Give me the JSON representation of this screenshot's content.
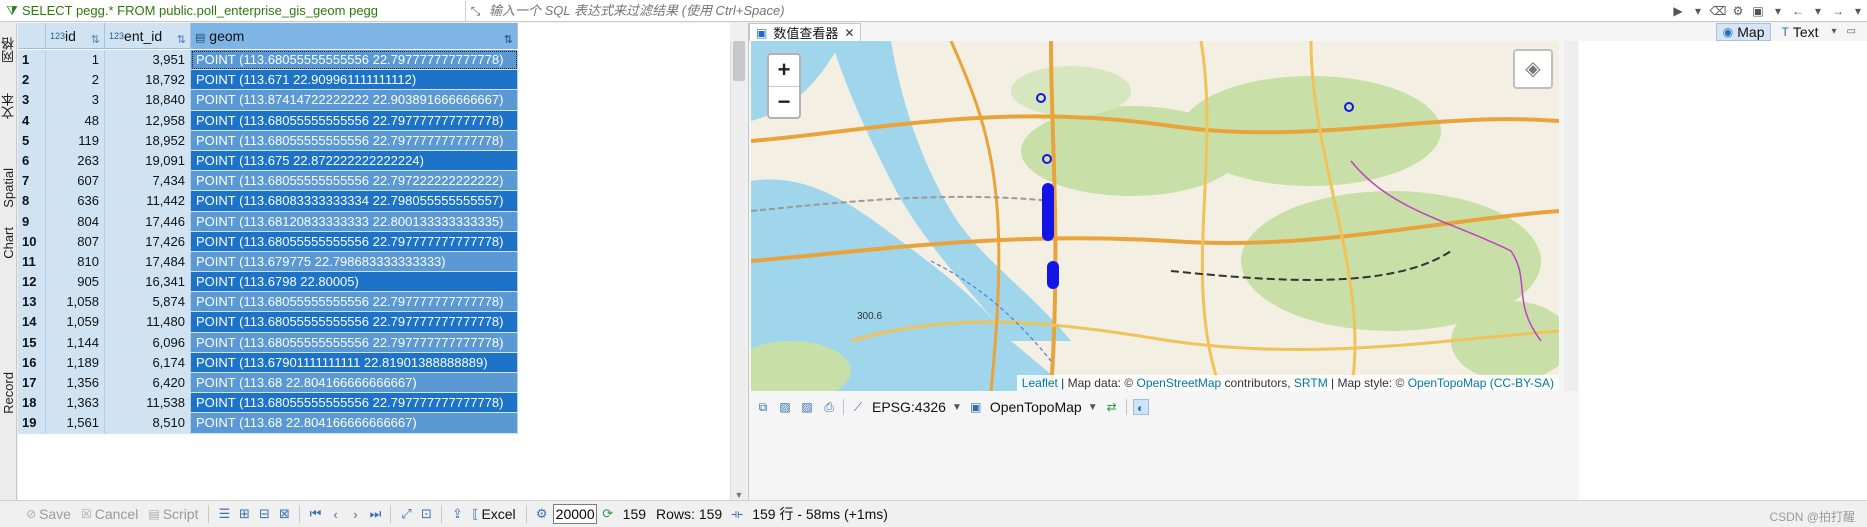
{
  "filter": {
    "sql": "SELECT pegg.* FROM public.poll_enterprise_gis_geom pegg",
    "placeholder": "输入一个 SQL 表达式来过滤结果 (使用 Ctrl+Space)"
  },
  "side_tabs": [
    "网格",
    "文本",
    "Spatial",
    "Chart",
    "Record"
  ],
  "grid": {
    "columns": [
      {
        "type": "123",
        "name": "id"
      },
      {
        "type": "123",
        "name": "ent_id"
      },
      {
        "type": "geom-icon",
        "name": "geom"
      }
    ],
    "rows": [
      {
        "n": "1",
        "id": "1",
        "ent_id": "3,951",
        "geom": "POINT (113.68055555555556 22.797777777777778)"
      },
      {
        "n": "2",
        "id": "2",
        "ent_id": "18,792",
        "geom": "POINT (113.671 22.909961111111112)"
      },
      {
        "n": "3",
        "id": "3",
        "ent_id": "18,840",
        "geom": "POINT (113.87414722222222 22.903891666666667)"
      },
      {
        "n": "4",
        "id": "48",
        "ent_id": "12,958",
        "geom": "POINT (113.68055555555556 22.797777777777778)"
      },
      {
        "n": "5",
        "id": "119",
        "ent_id": "18,952",
        "geom": "POINT (113.68055555555556 22.797777777777778)"
      },
      {
        "n": "6",
        "id": "263",
        "ent_id": "19,091",
        "geom": "POINT (113.675 22.872222222222224)"
      },
      {
        "n": "7",
        "id": "607",
        "ent_id": "7,434",
        "geom": "POINT (113.68055555555556 22.797222222222222)"
      },
      {
        "n": "8",
        "id": "636",
        "ent_id": "11,442",
        "geom": "POINT (113.68083333333334 22.798055555555557)"
      },
      {
        "n": "9",
        "id": "804",
        "ent_id": "17,446",
        "geom": "POINT (113.68120833333333 22.800133333333335)"
      },
      {
        "n": "10",
        "id": "807",
        "ent_id": "17,426",
        "geom": "POINT (113.68055555555556 22.797777777777778)"
      },
      {
        "n": "11",
        "id": "810",
        "ent_id": "17,484",
        "geom": "POINT (113.679775 22.798683333333333)"
      },
      {
        "n": "12",
        "id": "905",
        "ent_id": "16,341",
        "geom": "POINT (113.6798 22.80005)"
      },
      {
        "n": "13",
        "id": "1,058",
        "ent_id": "5,874",
        "geom": "POINT (113.68055555555556 22.797777777777778)"
      },
      {
        "n": "14",
        "id": "1,059",
        "ent_id": "11,480",
        "geom": "POINT (113.68055555555556 22.797777777777778)"
      },
      {
        "n": "15",
        "id": "1,144",
        "ent_id": "6,096",
        "geom": "POINT (113.68055555555556 22.797777777777778)"
      },
      {
        "n": "16",
        "id": "1,189",
        "ent_id": "6,174",
        "geom": "POINT (113.67901111111111 22.81901388888889)"
      },
      {
        "n": "17",
        "id": "1,356",
        "ent_id": "6,420",
        "geom": "POINT (113.68 22.804166666666667)"
      },
      {
        "n": "18",
        "id": "1,363",
        "ent_id": "11,538",
        "geom": "POINT (113.68055555555556 22.797777777777778)"
      },
      {
        "n": "19",
        "id": "1,561",
        "ent_id": "8,510",
        "geom": "POINT (113.68 22.804166666666667)"
      }
    ]
  },
  "viewer": {
    "tab_title": "数值查看器",
    "mode_map": "Map",
    "mode_text": "Text",
    "zoom_in": "+",
    "zoom_out": "−",
    "crs": "EPSG:4326",
    "basemap": "OpenTopoMap",
    "attribution": {
      "leaflet": "Leaflet",
      "sep1": " | Map data: © ",
      "osm": "OpenStreetMap",
      "contrib": " contributors, ",
      "srtm": "SRTM",
      "style": " | Map style: © ",
      "otm": "OpenTopoMap",
      "lic": "(CC-BY-SA)"
    },
    "map_labels": [
      "300.6"
    ]
  },
  "status": {
    "save": "Save",
    "cancel": "Cancel",
    "script": "Script",
    "excel": "Excel",
    "fetch_size": "20000",
    "count": "159",
    "rows": "Rows: 159",
    "summary": "159 行 - 58ms (+1ms)",
    "watermark": "CSDN @拍打醒"
  },
  "colors": {
    "geom_dark": "#1c73c8",
    "geom_light": "#5a99d3",
    "header_bg": "#cfe3f3",
    "sql_green": "#2b7a0b",
    "point_blue": "#1414e6"
  }
}
